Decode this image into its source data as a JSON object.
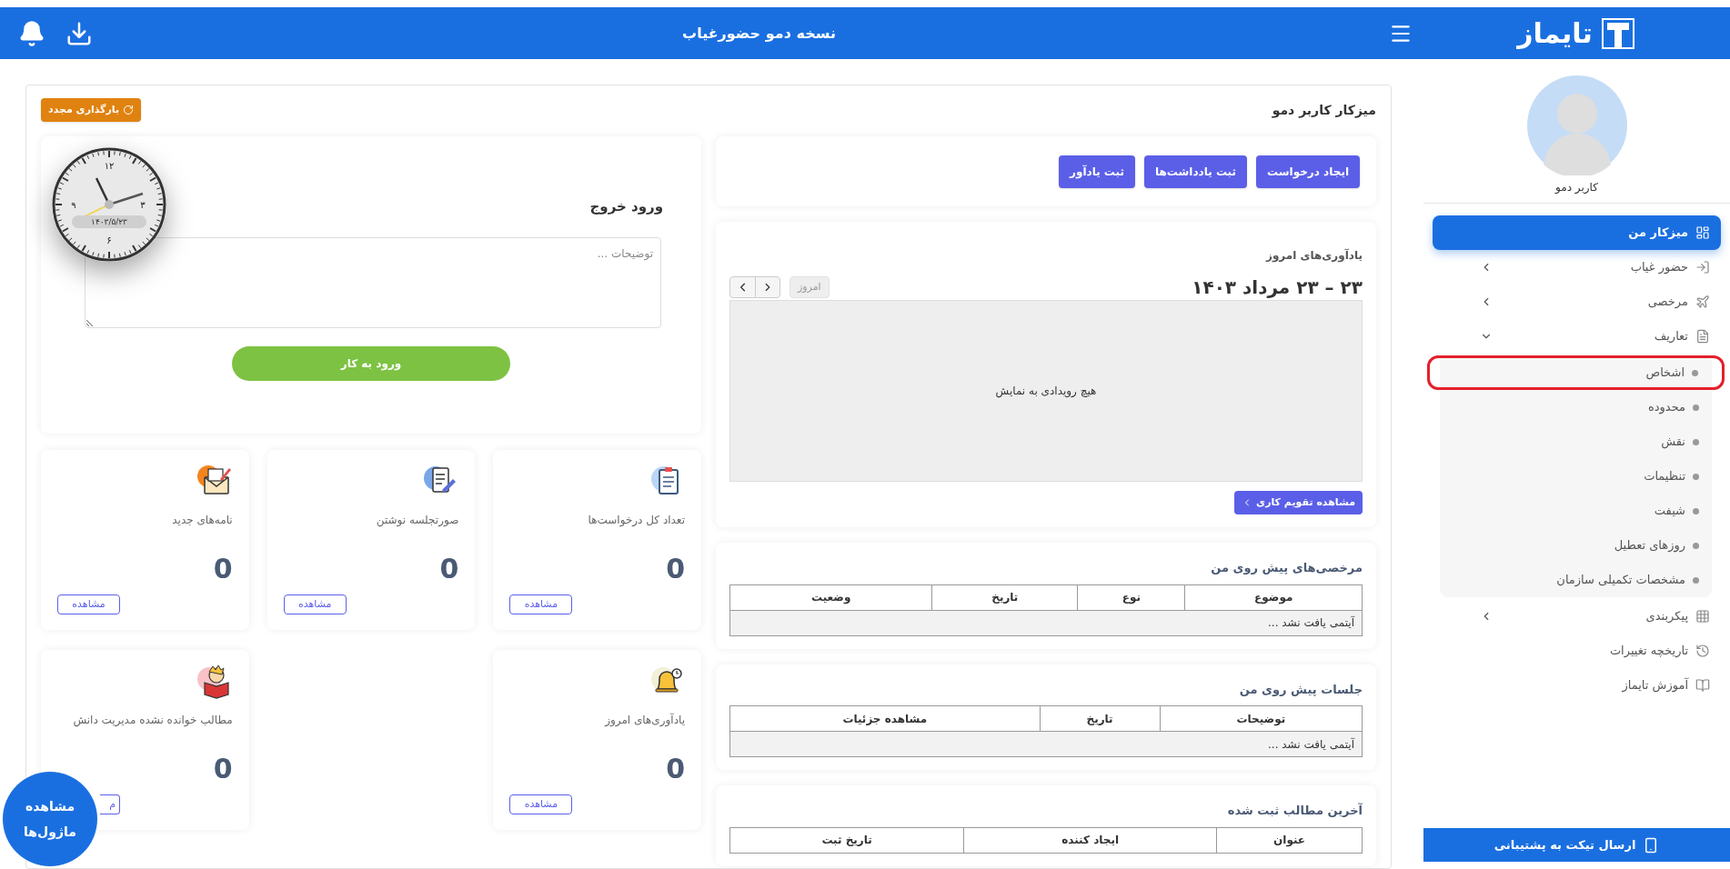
{
  "sidebar": {
    "logo": "تایماز",
    "user_name": "کاربر دمو",
    "menu": [
      {
        "label": "میزکار من",
        "selected": true
      },
      {
        "label": "حضور غیاب",
        "selected": false,
        "expanded": false
      },
      {
        "label": "مرخصی",
        "selected": false,
        "expanded": false
      },
      {
        "label": "تعاریف",
        "selected": false,
        "expanded": true,
        "children": [
          {
            "label": "اشخاص",
            "highlighted": true
          },
          {
            "label": "محدوده",
            "highlighted": false
          },
          {
            "label": "نقش",
            "highlighted": false
          },
          {
            "label": "تنظیمات",
            "highlighted": false
          },
          {
            "label": "شیفت",
            "highlighted": false
          },
          {
            "label": "روزهای تعطیل",
            "highlighted": false
          },
          {
            "label": "مشخصات تکمیلی سازمان",
            "highlighted": false
          }
        ]
      },
      {
        "label": "پیکربندی",
        "selected": false,
        "expanded": false
      },
      {
        "label": "تاریخچه تغییرات",
        "selected": false
      },
      {
        "label": "آموزش تایماز",
        "selected": false
      }
    ],
    "support_button": "ارسال تیکت به پشتیبانی"
  },
  "top_bar": {
    "title": "نسخه دمو حضورغیاب"
  },
  "dashboard": {
    "title": "میزکار کاربر دمو",
    "reload_button": "بارگذاری مجدد",
    "quick_actions": [
      "ایجاد درخواست",
      "ثبت یادداشت‌ها",
      "ثبت یادآور"
    ],
    "calendar": {
      "label": "یادآوری‌های امروز",
      "range_title": "۲۳ – ۲۳ مرداد ۱۴۰۳",
      "today_button": {
        "label": "امروز",
        "disabled": true
      },
      "empty_message": "هیچ رویدادی به نمایش",
      "view_button": "مشاهده تقویم کاری"
    },
    "tables": [
      {
        "title": "مرخصی‌های پیش روی من",
        "columns": [
          "موضوع",
          "نوع",
          "تاریخ",
          "وضعیت"
        ],
        "empty_message": "آیتمی یافت نشد ..."
      },
      {
        "title": "جلسات پیش روی من",
        "columns": [
          "توضیحات",
          "تاریخ",
          "مشاهده جزئیات"
        ],
        "empty_message": "آیتمی یافت نشد ..."
      },
      {
        "title": "آخرین مطالب ثبت شده",
        "columns": [
          "عنوان",
          "ایجاد کننده",
          "تاریخ ثبت"
        ]
      }
    ],
    "checkin": {
      "title": "ورود خروج",
      "clock": {
        "numerals": [
          "۱۲",
          "۳",
          "۶",
          "۹"
        ],
        "date": "۱۴۰۳/۵/۲۳"
      },
      "notes_placeholder": "توضیحات ...",
      "submit_button": "ورود به کار"
    },
    "stats": [
      [
        {
          "label": "تعداد کل درخواست‌ها",
          "value": "0",
          "button": "مشاهده"
        },
        {
          "label": "صورتجلسه نوشتن",
          "value": "0",
          "button": "مشاهده"
        },
        {
          "label": "نامه‌های جدید",
          "value": "0",
          "button": "مشاهده"
        }
      ],
      [
        {
          "label": "یادآوری‌های امروز",
          "value": "0",
          "button": "مشاهده"
        },
        {
          "kind": "empty"
        },
        {
          "label": "مطالب خوانده نشده مدیریت دانش",
          "value": "0",
          "button": "م",
          "button_clipped": true
        }
      ]
    ],
    "modules_button": "مشاهده ماژول‌ها"
  }
}
